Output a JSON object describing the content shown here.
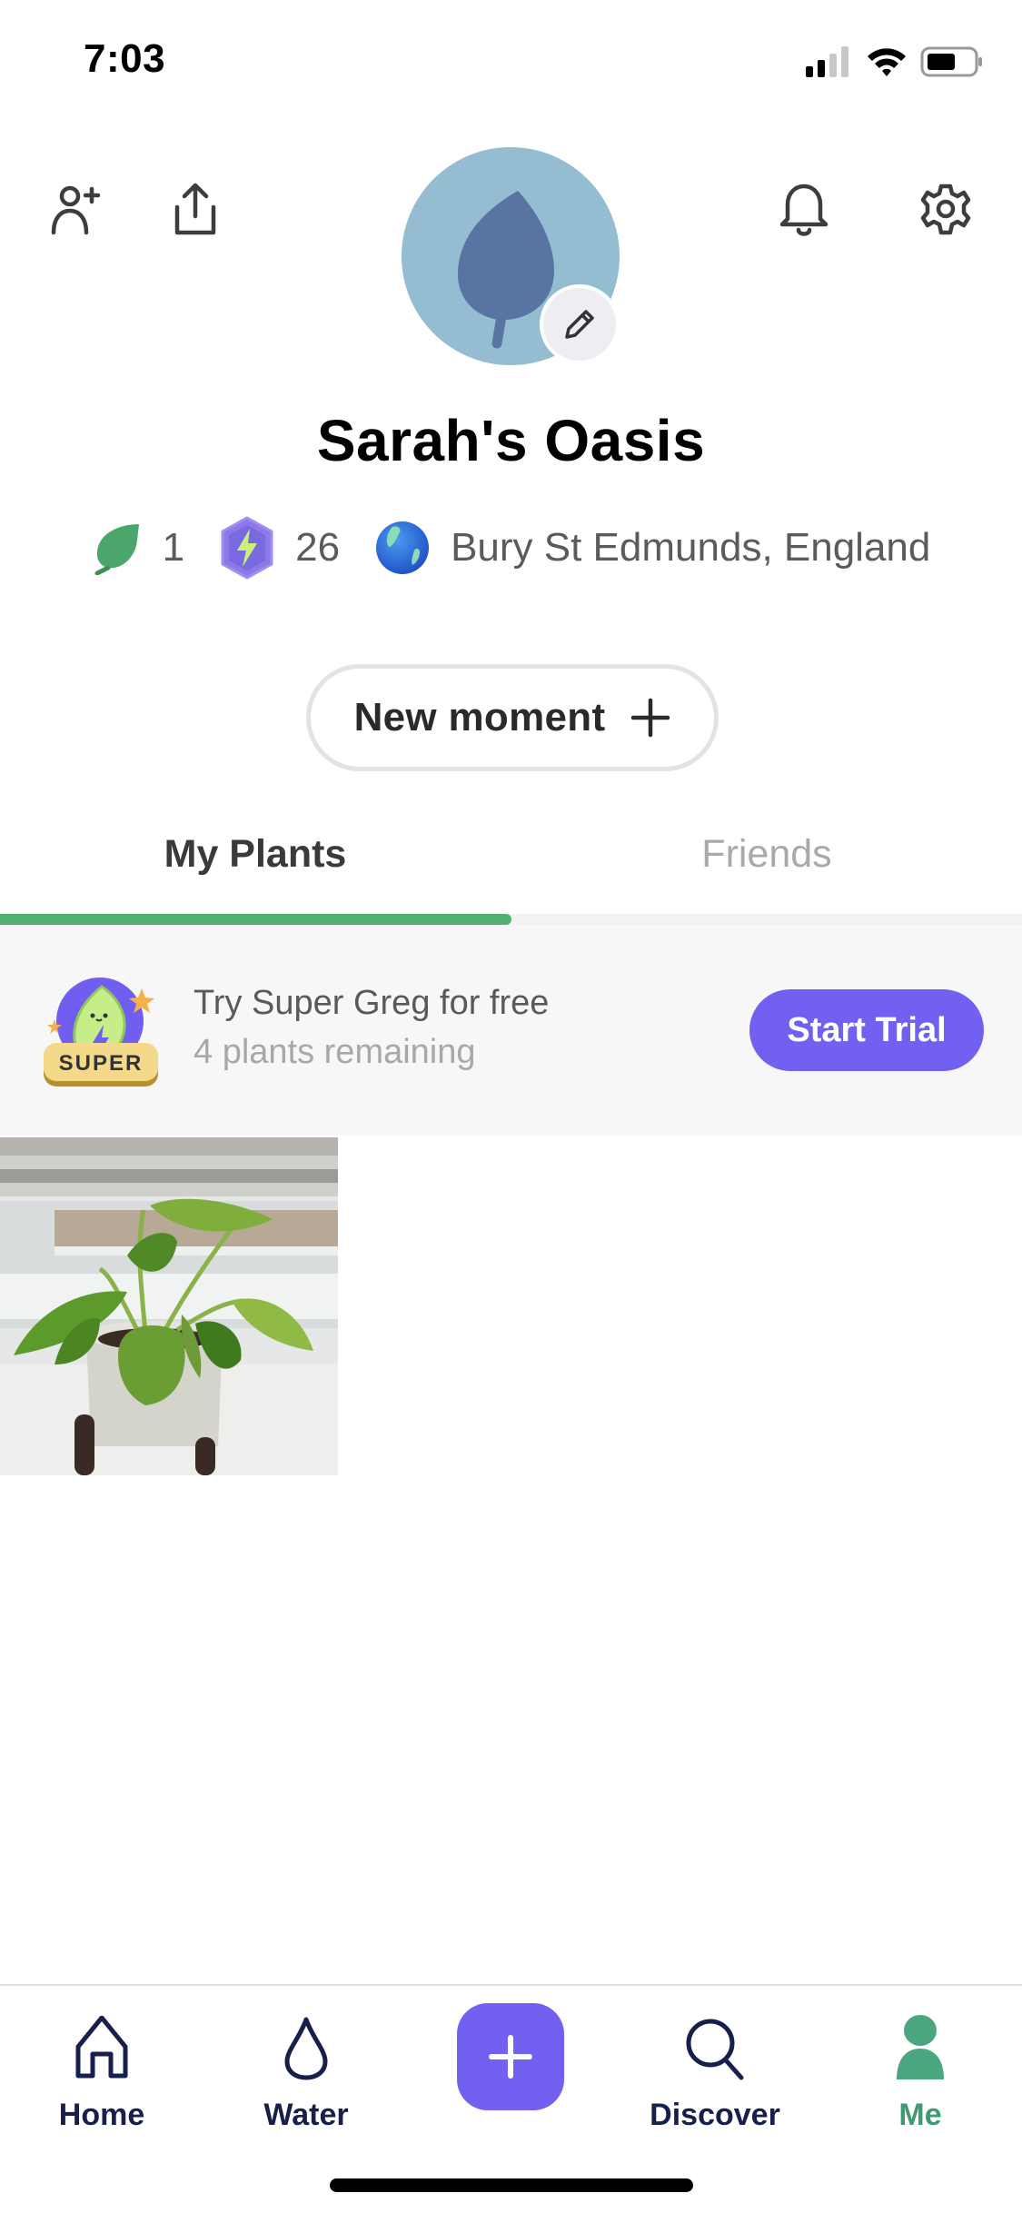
{
  "status_bar": {
    "time": "7:03",
    "signal_icon": "cellular-signal-icon",
    "wifi_icon": "wifi-icon",
    "battery_icon": "battery-icon"
  },
  "header": {
    "actions_left": [
      {
        "name": "add-friend",
        "icon": "person-plus-icon"
      },
      {
        "name": "share",
        "icon": "share-icon"
      }
    ],
    "actions_right": [
      {
        "name": "notifications",
        "icon": "bell-icon"
      },
      {
        "name": "settings",
        "icon": "gear-icon"
      }
    ],
    "avatar_icon": "leaf-icon",
    "avatar_edit_icon": "pencil-icon",
    "profile_name": "Sarah's Oasis"
  },
  "stats": {
    "plants_count": "1",
    "plants_icon": "leaf-icon",
    "points_count": "26",
    "points_icon": "lightning-gem-icon",
    "location": "Bury St Edmunds, England",
    "location_icon": "globe-icon"
  },
  "new_moment_button": {
    "label": "New moment",
    "icon": "plus-icon"
  },
  "tabs": [
    {
      "label": "My Plants",
      "active": true
    },
    {
      "label": "Friends",
      "active": false
    }
  ],
  "banner": {
    "badge_text": "SUPER",
    "title": "Try Super Greg for free",
    "subtitle": "4 plants remaining",
    "button_label": "Start Trial"
  },
  "plants": [
    {
      "description": "Pothos plant in white pot on windowsill"
    }
  ],
  "bottom_nav": {
    "items": [
      {
        "label": "Home",
        "icon": "home-icon",
        "active": false
      },
      {
        "label": "Water",
        "icon": "water-drop-icon",
        "active": false
      },
      {
        "label": "",
        "icon": "plus-icon",
        "active": false
      },
      {
        "label": "Discover",
        "icon": "search-icon",
        "active": false
      },
      {
        "label": "Me",
        "icon": "person-icon",
        "active": true
      }
    ]
  },
  "colors": {
    "accent_purple": "#7261f0",
    "accent_green": "#4fb072",
    "nav_text": "#17204a",
    "nav_active": "#3f9a70",
    "avatar_bg": "#95bdd1",
    "avatar_leaf": "#5974a2"
  }
}
